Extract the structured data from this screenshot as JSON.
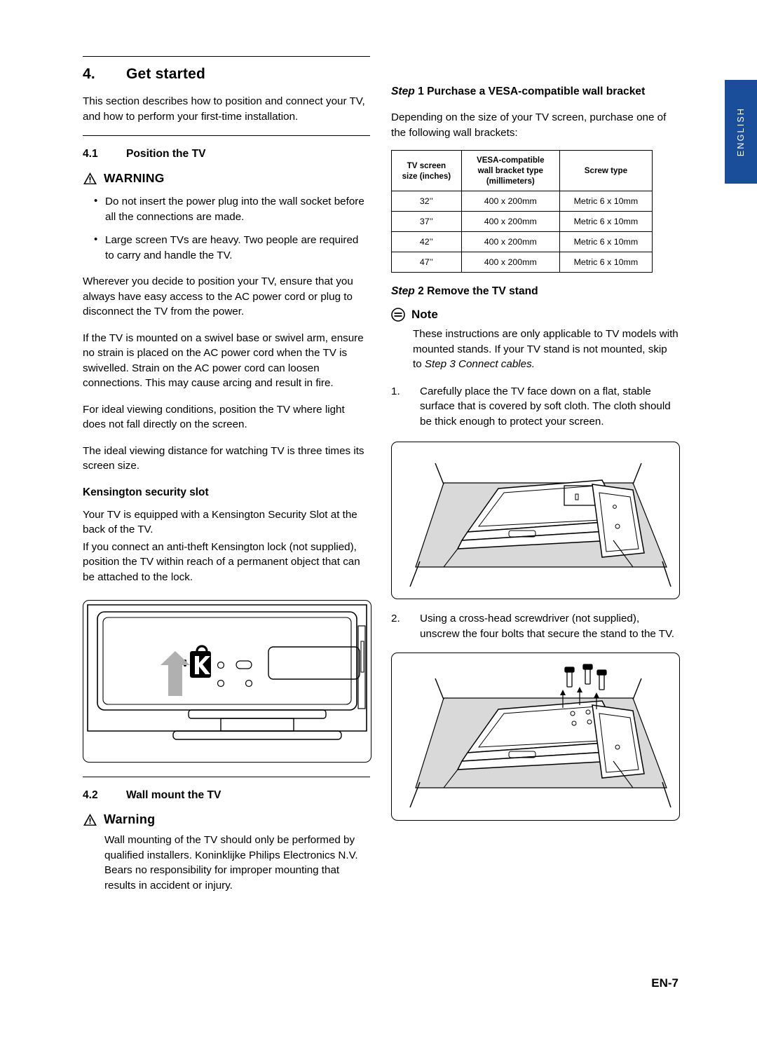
{
  "language_tab": {
    "label": "ENGLISH",
    "color": "#1a4e9b"
  },
  "left": {
    "section": {
      "number": "4.",
      "title": "Get started"
    },
    "intro": "This section describes how to position and connect your TV, and how to perform your first-time installation.",
    "sub_4_1": {
      "number": "4.1",
      "title": "Position the TV"
    },
    "warning_caps": "WARNING",
    "warning_bullets": [
      "Do not insert the power plug into the wall socket before all the connections are made.",
      "Large screen TVs are heavy.  Two people are required to carry and handle the TV."
    ],
    "paras": [
      "Wherever you decide to position your TV, ensure that you always have easy access to the AC power cord or plug to disconnect the TV from the power.",
      "If the TV is mounted on a swivel base or swivel arm, ensure no strain is placed on the AC power cord when the TV is swivelled.  Strain on the AC power cord can loosen connections. This may cause arcing and result in fire.",
      "For ideal viewing conditions, position the TV where light does not fall directly on the screen.",
      "The ideal viewing distance for watching TV is three times its screen size."
    ],
    "kensington_head": "Kensington security slot",
    "kensington_paras": [
      "Your TV is equipped with a Kensington Security Slot at the back of the TV.",
      "If you connect an anti-theft Kensington lock (not supplied), position the TV within reach of a permanent object that can be attached to the lock."
    ],
    "figure_kensington_alt": "Rear of TV showing Kensington security slot with arrow",
    "sub_4_2": {
      "number": "4.2",
      "title": "Wall mount the TV"
    },
    "warning_title": "Warning",
    "warning_body": "Wall mounting of the TV should only be performed by qualified installers. Koninklijke Philips Electronics N.V. Bears no responsibility for improper mounting that results in accident or injury."
  },
  "right": {
    "step1_head": "Step 1 Purchase a VESA-compatible wall bracket",
    "step1_label": "Step",
    "step1_num": "1",
    "step1_text": "Depending on the size of your TV screen, purchase one of the following wall brackets:",
    "table": {
      "headers": [
        "TV screen size (inches)",
        "VESA-compatible wall bracket type (millimeters)",
        "Screw type"
      ],
      "header_lines": [
        [
          "TV screen",
          "size (inches)"
        ],
        [
          "VESA-compatible",
          "wall bracket type",
          "(millimeters)"
        ],
        [
          "Screw type"
        ]
      ],
      "rows": [
        [
          "32’’",
          "400 x 200mm",
          "Metric 6 x 10mm"
        ],
        [
          "37’’",
          "400 x 200mm",
          "Metric 6 x 10mm"
        ],
        [
          "42’’",
          "400 x 200mm",
          "Metric 6 x 10mm"
        ],
        [
          "47’’",
          "400 x 200mm",
          "Metric 6 x 10mm"
        ]
      ]
    },
    "step2_head": "Step 2 Remove the TV stand",
    "step2_label": "Step",
    "step2_num": "2",
    "note_title": "Note",
    "note_text_plain": "These instructions are only applicable to TV models with mounted stands. If your TV stand is not mounted, skip to ",
    "note_text_italic": "Step 3 Connect cables.",
    "steps": [
      {
        "n": "1.",
        "text": "Carefully place the TV face down on a flat, stable surface that is covered by soft cloth. The cloth should be thick enough to protect your screen."
      },
      {
        "n": "2.",
        "text": "Using a cross-head screwdriver (not supplied), unscrew the four bolts that secure the stand to the TV."
      }
    ],
    "figure1_alt": "TV placed face down on a soft cloth covered surface",
    "figure2_alt": "Unscrewing the four bolts securing the TV stand"
  },
  "footer": {
    "page": "EN-7"
  }
}
